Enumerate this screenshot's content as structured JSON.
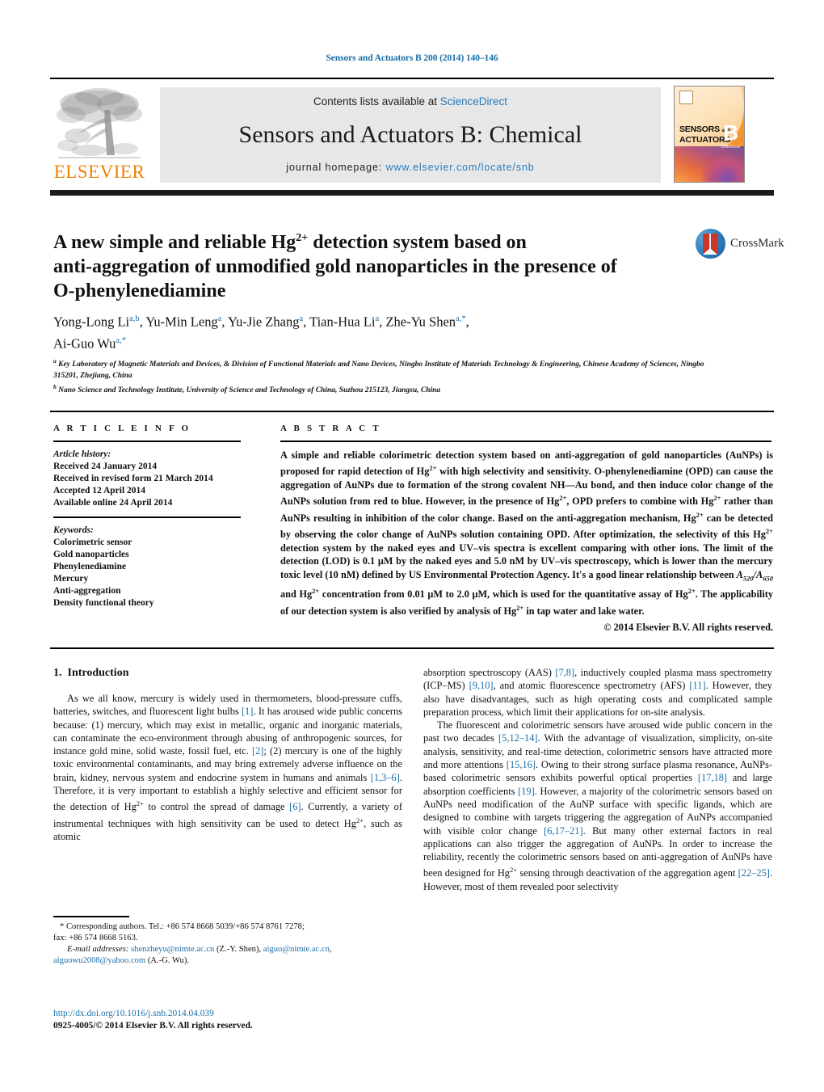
{
  "running_head": "Sensors and Actuators B 200 (2014) 140–146",
  "masthead": {
    "contents_prefix": "Contents lists available at ",
    "sciencedirect": "ScienceDirect",
    "journal_title": "Sensors and Actuators B: Chemical",
    "homepage_label": "journal homepage:",
    "homepage_url": "www.elsevier.com/locate/snb",
    "publisher_logo_text": "ELSEVIER",
    "cover": {
      "line1": "SENSORS",
      "and": "and",
      "line2": "ACTUATORS",
      "letter": "B",
      "sub": "Chemical"
    }
  },
  "crossmark": {
    "label": "CrossMark"
  },
  "article": {
    "title_line1": "A new simple and reliable Hg",
    "title_sup1": "2+",
    "title_line1b": " detection system based on",
    "title_line2": "anti-aggregation of unmodified gold nanoparticles in the presence of",
    "title_line3": "O-phenylenediamine",
    "authors_line1_a": "Yong-Long Li",
    "authors_sup1": "a,b",
    "authors_line1_b": ", Yu-Min Leng",
    "authors_sup2": "a",
    "authors_line1_c": ", Yu-Jie Zhang",
    "authors_sup3": "a",
    "authors_line1_d": ", Tian-Hua Li",
    "authors_sup4": "a",
    "authors_line1_e": ", Zhe-Yu Shen",
    "authors_sup5": "a,*",
    "authors_line1_f": ",",
    "authors_line2": "Ai-Guo Wu",
    "authors_sup6": "a,*",
    "affiliation_a_sup": "a",
    "affiliation_a": " Key Laboratory of Magnetic Materials and Devices, & Division of Functional Materials and Nano Devices, Ningbo Institute of Materials Technology & Engineering, Chinese Academy of Sciences, Ningbo 315201, Zhejiang, China",
    "affiliation_b_sup": "b",
    "affiliation_b": " Nano Science and Technology Institute, University of Science and Technology of China, Suzhou 215123, Jiangsu, China"
  },
  "article_info": {
    "heading": "A R T I C L E   I N F O",
    "history_label": "Article history:",
    "history": [
      "Received 24 January 2014",
      "Received in revised form 21 March 2014",
      "Accepted 12 April 2014",
      "Available online 24 April 2014"
    ],
    "keywords_label": "Keywords:",
    "keywords": [
      "Colorimetric sensor",
      "Gold nanoparticles",
      "Phenylenediamine",
      "Mercury",
      "Anti-aggregation",
      "Density functional theory"
    ]
  },
  "abstract": {
    "heading": "A B S T R A C T",
    "p1_s1": "A simple and reliable colorimetric detection system based on anti-aggregation of gold nanoparticles (AuNPs) is proposed for rapid detection of Hg",
    "sup_2plus": "2+",
    "p1_s2": " with high selectivity and sensitivity. O-phenylenediamine (OPD) can cause the aggregation of AuNPs due to formation of the strong covalent NH—Au bond, and then induce color change of the AuNPs solution from red to blue. However, in the presence of Hg",
    "p1_s3": ", OPD prefers to combine with Hg",
    "p1_s4": " rather than AuNPs resulting in inhibition of the color change. Based on the anti-aggregation mechanism, Hg",
    "p1_s5": " can be detected by observing the color change of AuNPs solution containing OPD. After optimization, the selectivity of this Hg",
    "p1_s6": " detection system by the naked eyes and UV–vis spectra is excellent comparing with other ions. The limit of the detection (LOD) is 0.1 μM by the naked eyes and 5.0 nM by UV–vis spectroscopy, which is lower than the mercury toxic level (10 nM) defined by US Environmental Protection Agency. It's a good linear relationship between ",
    "ratio_A": "A",
    "ratio_sub1": "520",
    "ratio_slash": "/A",
    "ratio_sub2": "650",
    "p1_s7": " and Hg",
    "p1_s8": " concentration from 0.01 μM to 2.0 μM, which is used for the quantitative assay of Hg",
    "p1_s9": ". The applicability of our detection system is also verified by analysis of Hg",
    "p1_s10": " in tap water and lake water.",
    "copyright": "© 2014 Elsevier B.V. All rights reserved."
  },
  "body": {
    "section_number": "1.",
    "section_title": "Introduction",
    "left": {
      "p1_a": "As we all know, mercury is widely used in thermometers, blood-pressure cuffs, batteries, switches, and fluorescent light bulbs ",
      "r1": "[1]",
      "p1_b": ". It has aroused wide public concerns because: (1) mercury, which may exist in metallic, organic and inorganic materials, can contaminate the eco-environment through abusing of anthropogenic sources, for instance gold mine, solid waste, fossil fuel, etc. ",
      "r2": "[2]",
      "p1_c": "; (2) mercury is one of the highly toxic environmental contaminants, and may bring extremely adverse influence on the brain, kidney, nervous system and endocrine system in humans and animals ",
      "r3": "[1,3–6]",
      "p1_d": ". Therefore, it is very important to establish a highly selective and efficient sensor for the detection of Hg",
      "sup": "2+",
      "p1_e": " to control the spread of damage ",
      "r4": "[6]",
      "p1_f": ". Currently, a variety of instrumental techniques with high sensitivity can be used to detect Hg",
      "p1_g": ", such as atomic"
    },
    "right": {
      "p1_a": "absorption spectroscopy (AAS) ",
      "r1": "[7,8]",
      "p1_b": ", inductively coupled plasma mass spectrometry (ICP–MS) ",
      "r2": "[9,10]",
      "p1_c": ", and atomic fluorescence spectrometry (AFS) ",
      "r3": "[11]",
      "p1_d": ". However, they also have disadvantages, such as high operating costs and complicated sample preparation process, which limit their applications for on-site analysis.",
      "p2_a": "The fluorescent and colorimetric sensors have aroused wide public concern in the past two decades ",
      "r4": "[5,12–14]",
      "p2_b": ". With the advantage of visualization, simplicity, on-site analysis, sensitivity, and real-time detection, colorimetric sensors have attracted more and more attentions ",
      "r5": "[15,16]",
      "p2_c": ". Owing to their strong surface plasma resonance, AuNPs-based colorimetric sensors exhibits powerful optical properties ",
      "r6": "[17,18]",
      "p2_d": " and large absorption coefficients ",
      "r7": "[19]",
      "p2_e": ". However, a majority of the colorimetric sensors based on AuNPs need modification of the AuNP surface with specific ligands, which are designed to combine with targets triggering the aggregation of AuNPs accompanied with visible color change ",
      "r8": "[6,17–21]",
      "p2_f": ". But many other external factors in real applications can also trigger the aggregation of AuNPs. In order to increase the reliability, recently the colorimetric sensors based on anti-aggregation of AuNPs have been designed for Hg",
      "sup": "2+",
      "p2_g": " sensing through deactivation of the aggregation agent ",
      "r9": "[22–25]",
      "p2_h": ". However, most of them revealed poor selectivity"
    }
  },
  "footnotes": {
    "star_line": "* Corresponding authors. Tel.: +86 574 8668 5039/+86 574 8761 7278;",
    "fax_line": "fax: +86 574 8668 5163.",
    "email_label": "E-mail addresses:",
    "email1": "shenzheyu@nimte.ac.cn",
    "email1_owner": " (Z.-Y. Shen), ",
    "email2": "aiguo@nimte.ac.cn",
    "email2_sep": ", ",
    "email3": "aiguowu2008@yahoo.com",
    "email3_owner": " (A.-G. Wu)."
  },
  "doi_block": {
    "doi": "http://dx.doi.org/10.1016/j.snb.2014.04.039",
    "issn": "0925-4005/© 2014 Elsevier B.V. All rights reserved."
  },
  "colors": {
    "link_blue": "#1a6ea8",
    "sciencedirect_blue": "#2b7bb9",
    "elsevier_orange": "#F08000",
    "banner_gray": "#e7e7e8"
  }
}
